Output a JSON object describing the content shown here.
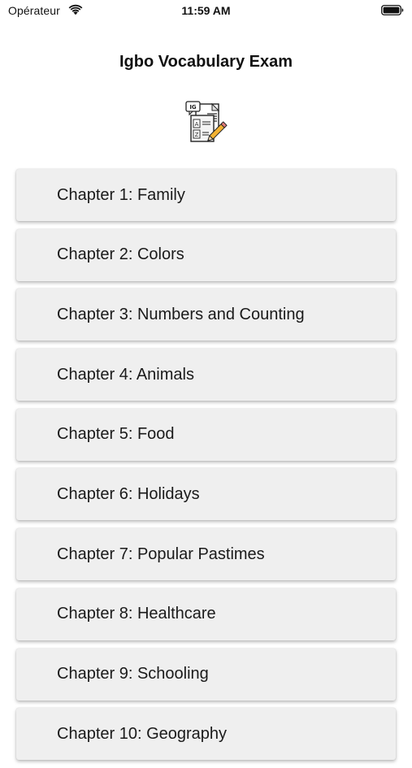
{
  "status_bar": {
    "carrier": "Opérateur",
    "time": "11:59 AM"
  },
  "header": {
    "title": "Igbo Vocabulary Exam",
    "logo_icon": "exam-document-pencil-icon",
    "logo_badge": "IG"
  },
  "chapters": [
    {
      "label": "Chapter 1: Family"
    },
    {
      "label": "Chapter 2: Colors"
    },
    {
      "label": "Chapter 3: Numbers and Counting"
    },
    {
      "label": "Chapter 4: Animals"
    },
    {
      "label": "Chapter 5: Food"
    },
    {
      "label": "Chapter 6: Holidays"
    },
    {
      "label": "Chapter 7: Popular Pastimes"
    },
    {
      "label": "Chapter 8: Healthcare"
    },
    {
      "label": "Chapter 9: Schooling"
    },
    {
      "label": "Chapter 10: Geography"
    }
  ],
  "colors": {
    "item_background": "#efefef",
    "page_background": "#ffffff",
    "text": "#111111"
  }
}
